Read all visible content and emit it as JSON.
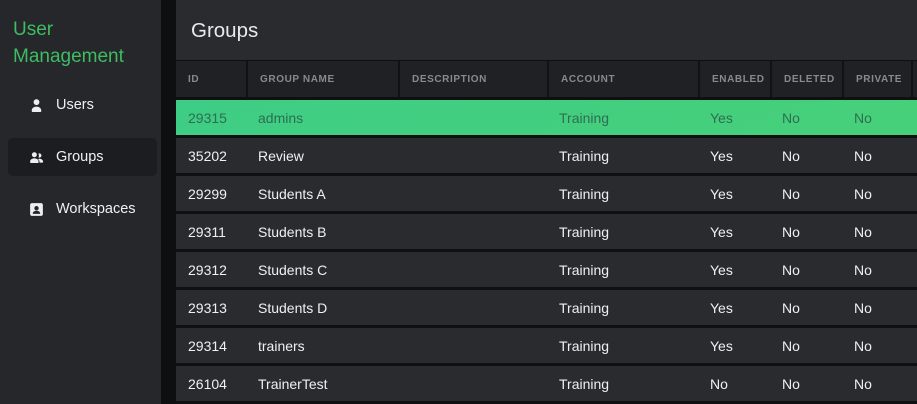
{
  "sidebar": {
    "title": "User Management",
    "items": [
      {
        "label": "Users",
        "icon": "user-icon",
        "selected": false
      },
      {
        "label": "Groups",
        "icon": "users-icon",
        "selected": true
      },
      {
        "label": "Workspaces",
        "icon": "workspace-badge-icon",
        "selected": false
      }
    ]
  },
  "main": {
    "title": "Groups"
  },
  "table": {
    "columns": [
      "ID",
      "GROUP NAME",
      "DESCRIPTION",
      "ACCOUNT",
      "ENABLED",
      "DELETED",
      "PRIVATE"
    ],
    "rows": [
      {
        "id": "29315",
        "group_name": "admins",
        "description": "",
        "account": "Training",
        "enabled": "Yes",
        "deleted": "No",
        "private": "No",
        "selected": true
      },
      {
        "id": "35202",
        "group_name": "Review",
        "description": "",
        "account": "Training",
        "enabled": "Yes",
        "deleted": "No",
        "private": "No",
        "selected": false
      },
      {
        "id": "29299",
        "group_name": "Students A",
        "description": "",
        "account": "Training",
        "enabled": "Yes",
        "deleted": "No",
        "private": "No",
        "selected": false
      },
      {
        "id": "29311",
        "group_name": "Students B",
        "description": "",
        "account": "Training",
        "enabled": "Yes",
        "deleted": "No",
        "private": "No",
        "selected": false
      },
      {
        "id": "29312",
        "group_name": "Students C",
        "description": "",
        "account": "Training",
        "enabled": "Yes",
        "deleted": "No",
        "private": "No",
        "selected": false
      },
      {
        "id": "29313",
        "group_name": "Students D",
        "description": "",
        "account": "Training",
        "enabled": "Yes",
        "deleted": "No",
        "private": "No",
        "selected": false
      },
      {
        "id": "29314",
        "group_name": "trainers",
        "description": "",
        "account": "Training",
        "enabled": "Yes",
        "deleted": "No",
        "private": "No",
        "selected": false
      },
      {
        "id": "26104",
        "group_name": "TrainerTest",
        "description": "",
        "account": "Training",
        "enabled": "No",
        "deleted": "No",
        "private": "No",
        "selected": false
      }
    ]
  },
  "colors": {
    "accent_green": "#3fbc61",
    "selected_row_green": "#44ce7d",
    "sidebar_bg": "#25272b",
    "main_bg": "#292b2f",
    "table_header_bg": "#1f2125"
  }
}
